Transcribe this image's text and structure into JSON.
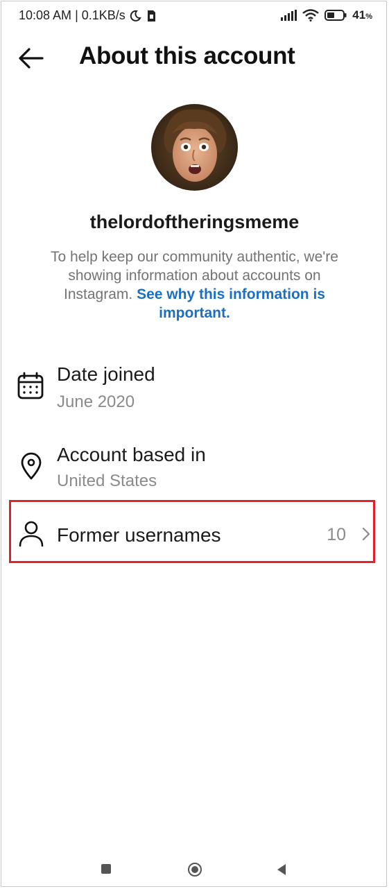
{
  "status_bar": {
    "time": "10:08 AM",
    "separator": "|",
    "net_speed": "0.1KB/s",
    "battery_percent": "41",
    "battery_unit": "%",
    "icons": [
      "moon-icon",
      "sim-icon",
      "signal-icon",
      "wifi-icon",
      "battery-icon"
    ]
  },
  "header": {
    "back_icon": "back-arrow-icon",
    "title": "About this account"
  },
  "profile": {
    "username": "thelordoftheringsmeme",
    "info_text": "To help keep our community authentic, we're showing information about accounts on Instagram.",
    "info_link": "See why this information is important."
  },
  "details": {
    "date_joined": {
      "icon": "calendar-icon",
      "label": "Date joined",
      "value": "June 2020"
    },
    "location": {
      "icon": "location-pin-icon",
      "label": "Account based in",
      "value": "United States"
    },
    "former_usernames": {
      "icon": "person-icon",
      "label": "Former usernames",
      "count": "10",
      "chevron": "chevron-right-icon"
    }
  },
  "colors": {
    "link": "#1a6fc4",
    "highlight_border": "#e0202a",
    "secondary_text": "#8a8a8a"
  },
  "nav_bar": {
    "icons": [
      "recents-square-icon",
      "home-circle-icon",
      "back-triangle-icon"
    ]
  }
}
